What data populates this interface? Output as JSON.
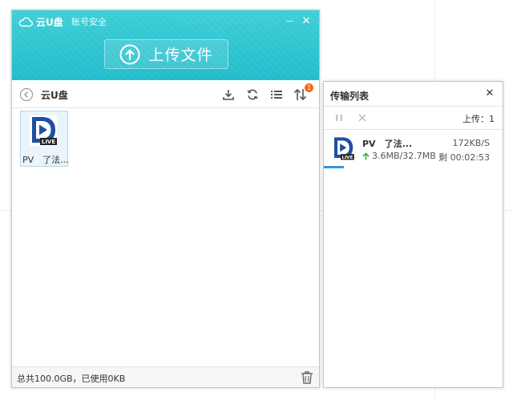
{
  "app": {
    "brand_name": "云U盘",
    "account_link": "账号安全",
    "minimize_glyph": "—",
    "close_glyph": "✕",
    "upload_label": "上传文件"
  },
  "toolbar": {
    "breadcrumb": "云U盘",
    "transfer_badge": "1"
  },
  "files": [
    {
      "name": "PV　了法...",
      "thumb_label": "LIVE"
    }
  ],
  "status": {
    "quota_text": "总共100.0GB，已使用0KB"
  },
  "transfer": {
    "title": "传输列表",
    "close_glyph": "✕",
    "upload_count": "上传：1",
    "tasks": [
      {
        "name": "PV　了法...",
        "speed": "172KB/S",
        "size": "3.6MB/32.7MB",
        "eta": "剩 00:02:53",
        "progress": 0.11,
        "thumb_label": "LIVE"
      }
    ]
  },
  "colors": {
    "header_teal": "#21bccb",
    "accent_blue": "#2c9be0",
    "badge_orange": "#f26a1b",
    "upload_green": "#3cae3c"
  }
}
